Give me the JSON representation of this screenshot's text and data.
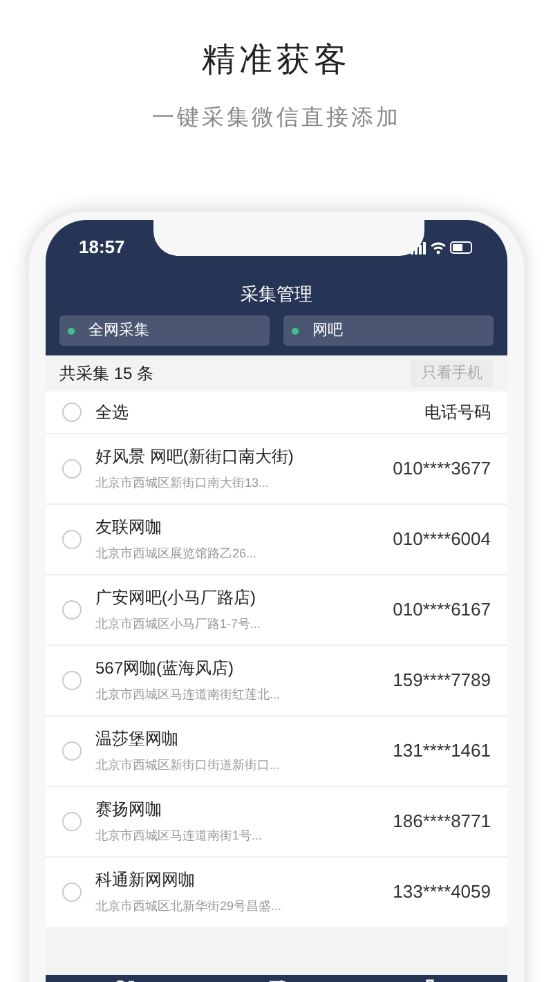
{
  "headline": {
    "title": "精准获客",
    "subtitle": "一键采集微信直接添加"
  },
  "status_bar": {
    "time": "18:57"
  },
  "screen_title": "采集管理",
  "filters": [
    {
      "label": "全网采集"
    },
    {
      "label": "网吧"
    }
  ],
  "summary": {
    "count": "共采集 15 条",
    "phone_only_button": "只看手机"
  },
  "list_header": {
    "select_all": {
      "label": "全选",
      "checked": false
    },
    "column_2": "电话号码"
  },
  "rows": [
    {
      "name": "好风景 网吧(新街口南大街)",
      "address": "北京市西城区新街口南大街13...",
      "phone": "010****3677",
      "selected": false
    },
    {
      "name": "友联网咖",
      "address": "北京市西城区展览馆路乙26...",
      "phone": "010****6004",
      "selected": false
    },
    {
      "name": "广安网吧(小马厂路店)",
      "address": "北京市西城区小马厂路1-7号...",
      "phone": "010****6167",
      "selected": false
    },
    {
      "name": "567网咖(蓝海风店)",
      "address": "北京市西城区马连道南街红莲北...",
      "phone": "159****7789",
      "selected": false
    },
    {
      "name": "温莎堡网咖",
      "address": "北京市西城区新街口街道新街口...",
      "phone": "131****1461",
      "selected": false
    },
    {
      "name": "赛扬网咖",
      "address": "北京市西城区马连道南街1号...",
      "phone": "186****8771",
      "selected": false
    },
    {
      "name": "科通新网网咖",
      "address": "北京市西城区北新华街29号昌盛...",
      "phone": "133****4059",
      "selected": false
    }
  ]
}
